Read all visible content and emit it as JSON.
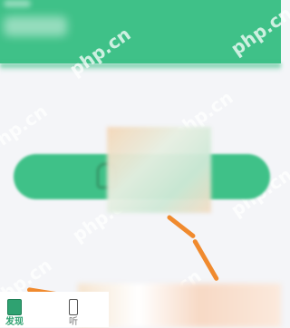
{
  "watermark": {
    "text": "php.cn"
  },
  "bottom_nav": {
    "items": [
      {
        "label": "发现",
        "icon": "book-icon",
        "active": true
      },
      {
        "label": "听",
        "icon": "phone-icon",
        "active": false
      }
    ]
  },
  "colors": {
    "primary_green": "#3fc188",
    "active_green": "#2fa271",
    "arrow_orange": "#f08a2e",
    "background": "#f4f5f8"
  }
}
